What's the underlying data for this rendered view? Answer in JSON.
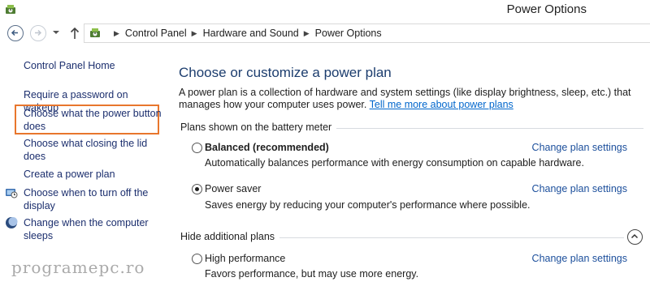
{
  "window": {
    "title": "Power Options",
    "app_icon": "power-options-icon"
  },
  "navigation": {
    "back_icon": "back-arrow-icon",
    "forward_icon": "forward-arrow-icon",
    "recent_icon": "chevron-down-icon",
    "up_icon": "up-arrow-icon",
    "breadcrumbs": [
      "Control Panel",
      "Hardware and Sound",
      "Power Options"
    ]
  },
  "sidebar": {
    "home": "Control Panel Home",
    "items": [
      {
        "label": "Require a password on wakeup"
      },
      {
        "label": "Choose what the power button does",
        "highlight_color": "#e8762d"
      },
      {
        "label": "Choose what closing the lid does"
      },
      {
        "label": "Create a power plan"
      },
      {
        "label": "Choose when to turn off the display",
        "icon": "display-timer-icon"
      },
      {
        "label": "Change when the computer sleeps",
        "icon": "sleep-moon-icon"
      }
    ]
  },
  "main": {
    "title": "Choose or customize a power plan",
    "intro_text": "A power plan is a collection of hardware and system settings (like display brightness, sleep, etc.) that manages how your computer uses power.",
    "intro_link": "Tell me more about power plans",
    "battery_section": "Plans shown on the battery meter",
    "hidden_section": "Hide additional plans",
    "change_link_label": "Change plan settings",
    "plans": [
      {
        "name": "Balanced (recommended)",
        "description": "Automatically balances performance with energy consumption on capable hardware.",
        "selected": false
      },
      {
        "name": "Power saver",
        "description": "Saves energy by reducing your computer's performance where possible.",
        "selected": true
      },
      {
        "name": "High performance",
        "description": "Favors performance, but may use more energy.",
        "selected": false
      }
    ]
  },
  "watermark": "programepc.ro",
  "colors": {
    "link": "#1c2f6e",
    "title": "#1c3d6e",
    "highlight": "#e8762d"
  }
}
